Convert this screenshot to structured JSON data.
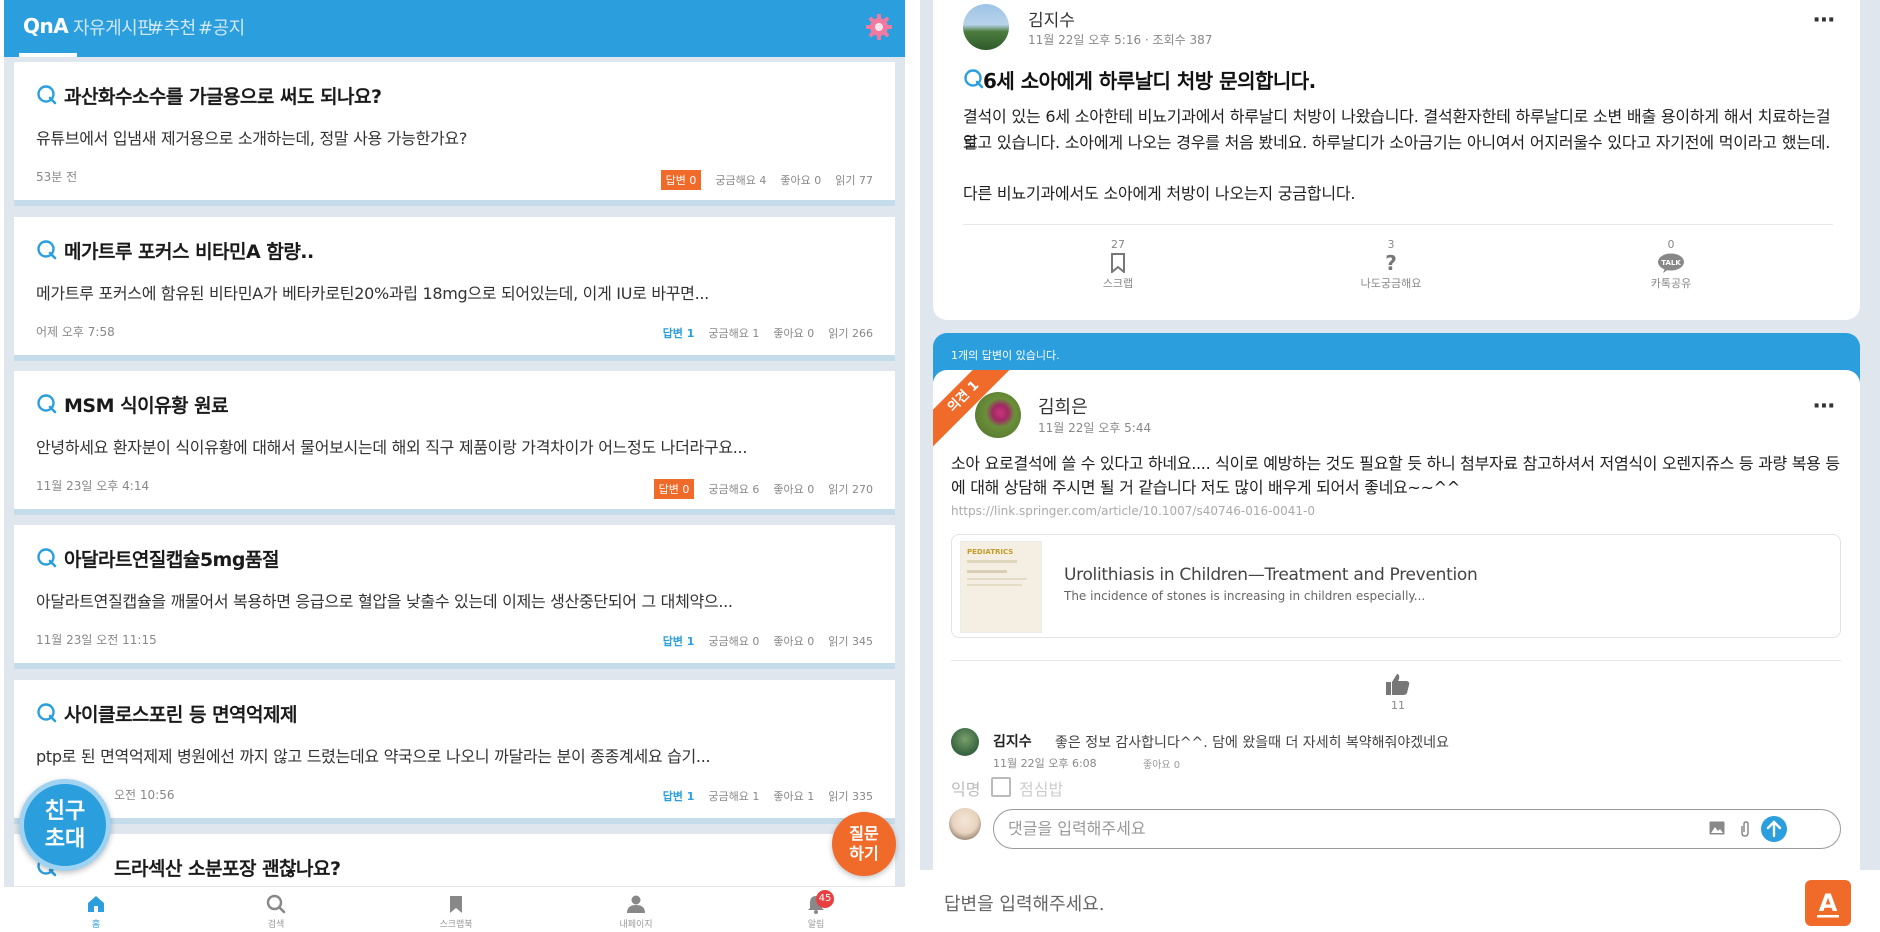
{
  "left": {
    "tabs": [
      {
        "label": "QnA"
      },
      {
        "label": "자유게시판"
      },
      {
        "label": "#추천"
      },
      {
        "label": "#공지"
      }
    ],
    "posts": [
      {
        "title": "과산화수소수를 가글용으로 써도 되나요?",
        "body": "유튜브에서 입냄새 제거용으로 소개하는데, 정말 사용 가능한가요?",
        "time": "53분 전",
        "answers": "답변 0",
        "curious": "궁금해요 4",
        "likes": "좋아요 0",
        "reads": "읽기 77",
        "answered": false
      },
      {
        "title": "메가트루 포커스 비타민A 함량..",
        "body": "메가트루 포커스에 함유된 비타민A가 베타카로틴20%과립 18mg으로 되어있는데, 이게 IU로 바꾸면...",
        "time": "어제 오후 7:58",
        "answers": "답변 1",
        "curious": "궁금해요 1",
        "likes": "좋아요 0",
        "reads": "읽기 266",
        "answered": true
      },
      {
        "title": "MSM 식이유황 원료",
        "body": "안녕하세요 환자분이 식이유황에 대해서 물어보시는데 해외 직구 제품이랑 가격차이가 어느정도 나더라구요...",
        "time": "11월 23일 오후 4:14",
        "answers": "답변 0",
        "curious": "궁금해요 6",
        "likes": "좋아요 0",
        "reads": "읽기 270",
        "answered": false
      },
      {
        "title": "아달라트연질캡슐5mg품절",
        "body": "아달라트연질캡슐을 깨물어서 복용하면 응급으로 혈압을 낮출수 있는데 이제는 생산중단되어 그 대체약으...",
        "time": "11월 23일 오전 11:15",
        "answers": "답변 1",
        "curious": "궁금해요 0",
        "likes": "좋아요 0",
        "reads": "읽기 345",
        "answered": true
      },
      {
        "title": "사이클로스포린 등 면역억제제",
        "body": "ptp로 된 면역억제제 병원에선 까지 않고 드렸는데요 약국으로 나오니 까달라는 분이 종종계세요 습기...",
        "time": "오전 10:56",
        "answers": "답변 1",
        "curious": "궁금해요 1",
        "likes": "좋아요 1",
        "reads": "읽기 335",
        "answered": true
      },
      {
        "title": "드라섹산 소분포장 괜찮나요?"
      }
    ],
    "invite_line1": "친구",
    "invite_line2": "초대",
    "ask_line1": "질문",
    "ask_line2": "하기",
    "nav": [
      {
        "label": "홈",
        "icon": "home-icon"
      },
      {
        "label": "검색",
        "icon": "search-icon"
      },
      {
        "label": "스크랩북",
        "icon": "bookmark-icon"
      },
      {
        "label": "내페이지",
        "icon": "person-icon"
      },
      {
        "label": "알림",
        "icon": "bell-icon"
      }
    ],
    "notif_count": "45"
  },
  "right": {
    "post": {
      "author": "김지수",
      "meta": "11월 22일 오후 5:16 · 조회수 387",
      "title": "6세 소아에게 하루날디 처방 문의합니다.",
      "body_line1": "결석이 있는 6세 소아한테 비뇨기과에서 하루날디 처방이 나왔습니다. 결석환자한테 하루날디로 소변 배출 용이하게 해서 치료하는걸로",
      "body_line2": "알고 있습니다. 소아에게 나오는 경우를 처음 봤네요. 하루날디가 소아금기는 아니여서 어지러울수 있다고 자기전에 먹이라고 했는데.",
      "body_line3": "다른 비뇨기과에서도 소아에게 처방이 나오는지 궁금합니다.",
      "actions": [
        {
          "count": "27",
          "label": "스크랩"
        },
        {
          "count": "3",
          "label": "나도궁금해요"
        },
        {
          "count": "0",
          "label": "카톡공유"
        }
      ]
    },
    "answers_count": "1개의 답변이 있습니다.",
    "answer": {
      "ribbon": "의견 1",
      "author": "김희은",
      "meta": "11월 22일 오후 5:44",
      "body_line1": "소아 요로결석에 쓸 수 있다고 하네요.... 식이로 예방하는 것도 필요할 듯 하니 첨부자료 참고하셔서 저염식이 오렌지쥬스 등 과량 복용 등",
      "body_line2": "에 대해 상담해 주시면 될 거 같습니다 저도 많이 배우게 되어서 좋네요~~^^",
      "link": "https://link.springer.com/article/10.1007/s40746-016-0041-0",
      "link_title": "Urolithiasis in Children—Treatment and Prevention",
      "link_desc": "The incidence of stones is increasing in children especially...",
      "link_thumb_text": "PEDIATRICS",
      "likes": "11"
    },
    "comment": {
      "author": "김지수",
      "text": "좋은 정보 감사합니다^^. 담에 왔을때 더 자세히 복약해줘야겠네요",
      "time": "11월 22일 오후 6:08",
      "likes": "좋아요 0"
    },
    "anon_label": "익명",
    "anon_name": "점심밥",
    "comment_placeholder": "댓글을 입력해주세요",
    "answer_placeholder": "답변을 입력해주세요.",
    "answer_btn_glyph": "A"
  },
  "colors": {
    "primary": "#2b9ede",
    "accent": "#f06a2a"
  }
}
